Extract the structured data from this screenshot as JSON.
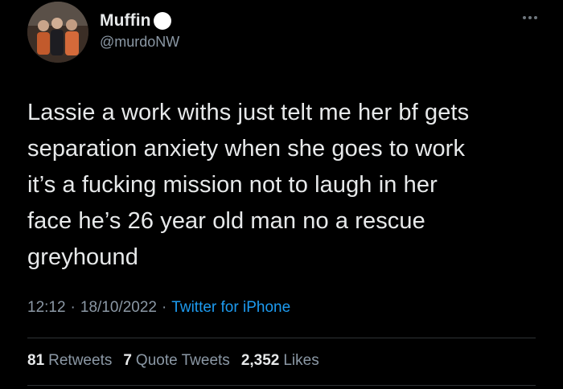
{
  "author": {
    "display_name": "Muffin",
    "handle": "@murdoNW",
    "avatar_icon": "avatar-photo"
  },
  "tweet": {
    "text": "Lassie a work withs just telt me her bf gets\nseparation anxiety when she goes to work\nit’s a fucking mission not to laugh in her\nface he’s 26 year old man no a rescue\ngreyhound"
  },
  "meta": {
    "time": "12:12",
    "separator1": "·",
    "date": "18/10/2022",
    "separator2": "·",
    "source": "Twitter for iPhone"
  },
  "stats": {
    "retweets_count": "81",
    "retweets_label": "Retweets",
    "quotes_count": "7",
    "quotes_label": "Quote Tweets",
    "likes_count": "2,352",
    "likes_label": "Likes"
  },
  "colors": {
    "background": "#000000",
    "text": "#e7e9ea",
    "secondary": "#8b98a5",
    "link": "#1d9bf0",
    "divider": "#2f3336"
  },
  "icons": {
    "more": "more-dots-icon",
    "name_emoji": "white-circle-icon"
  }
}
